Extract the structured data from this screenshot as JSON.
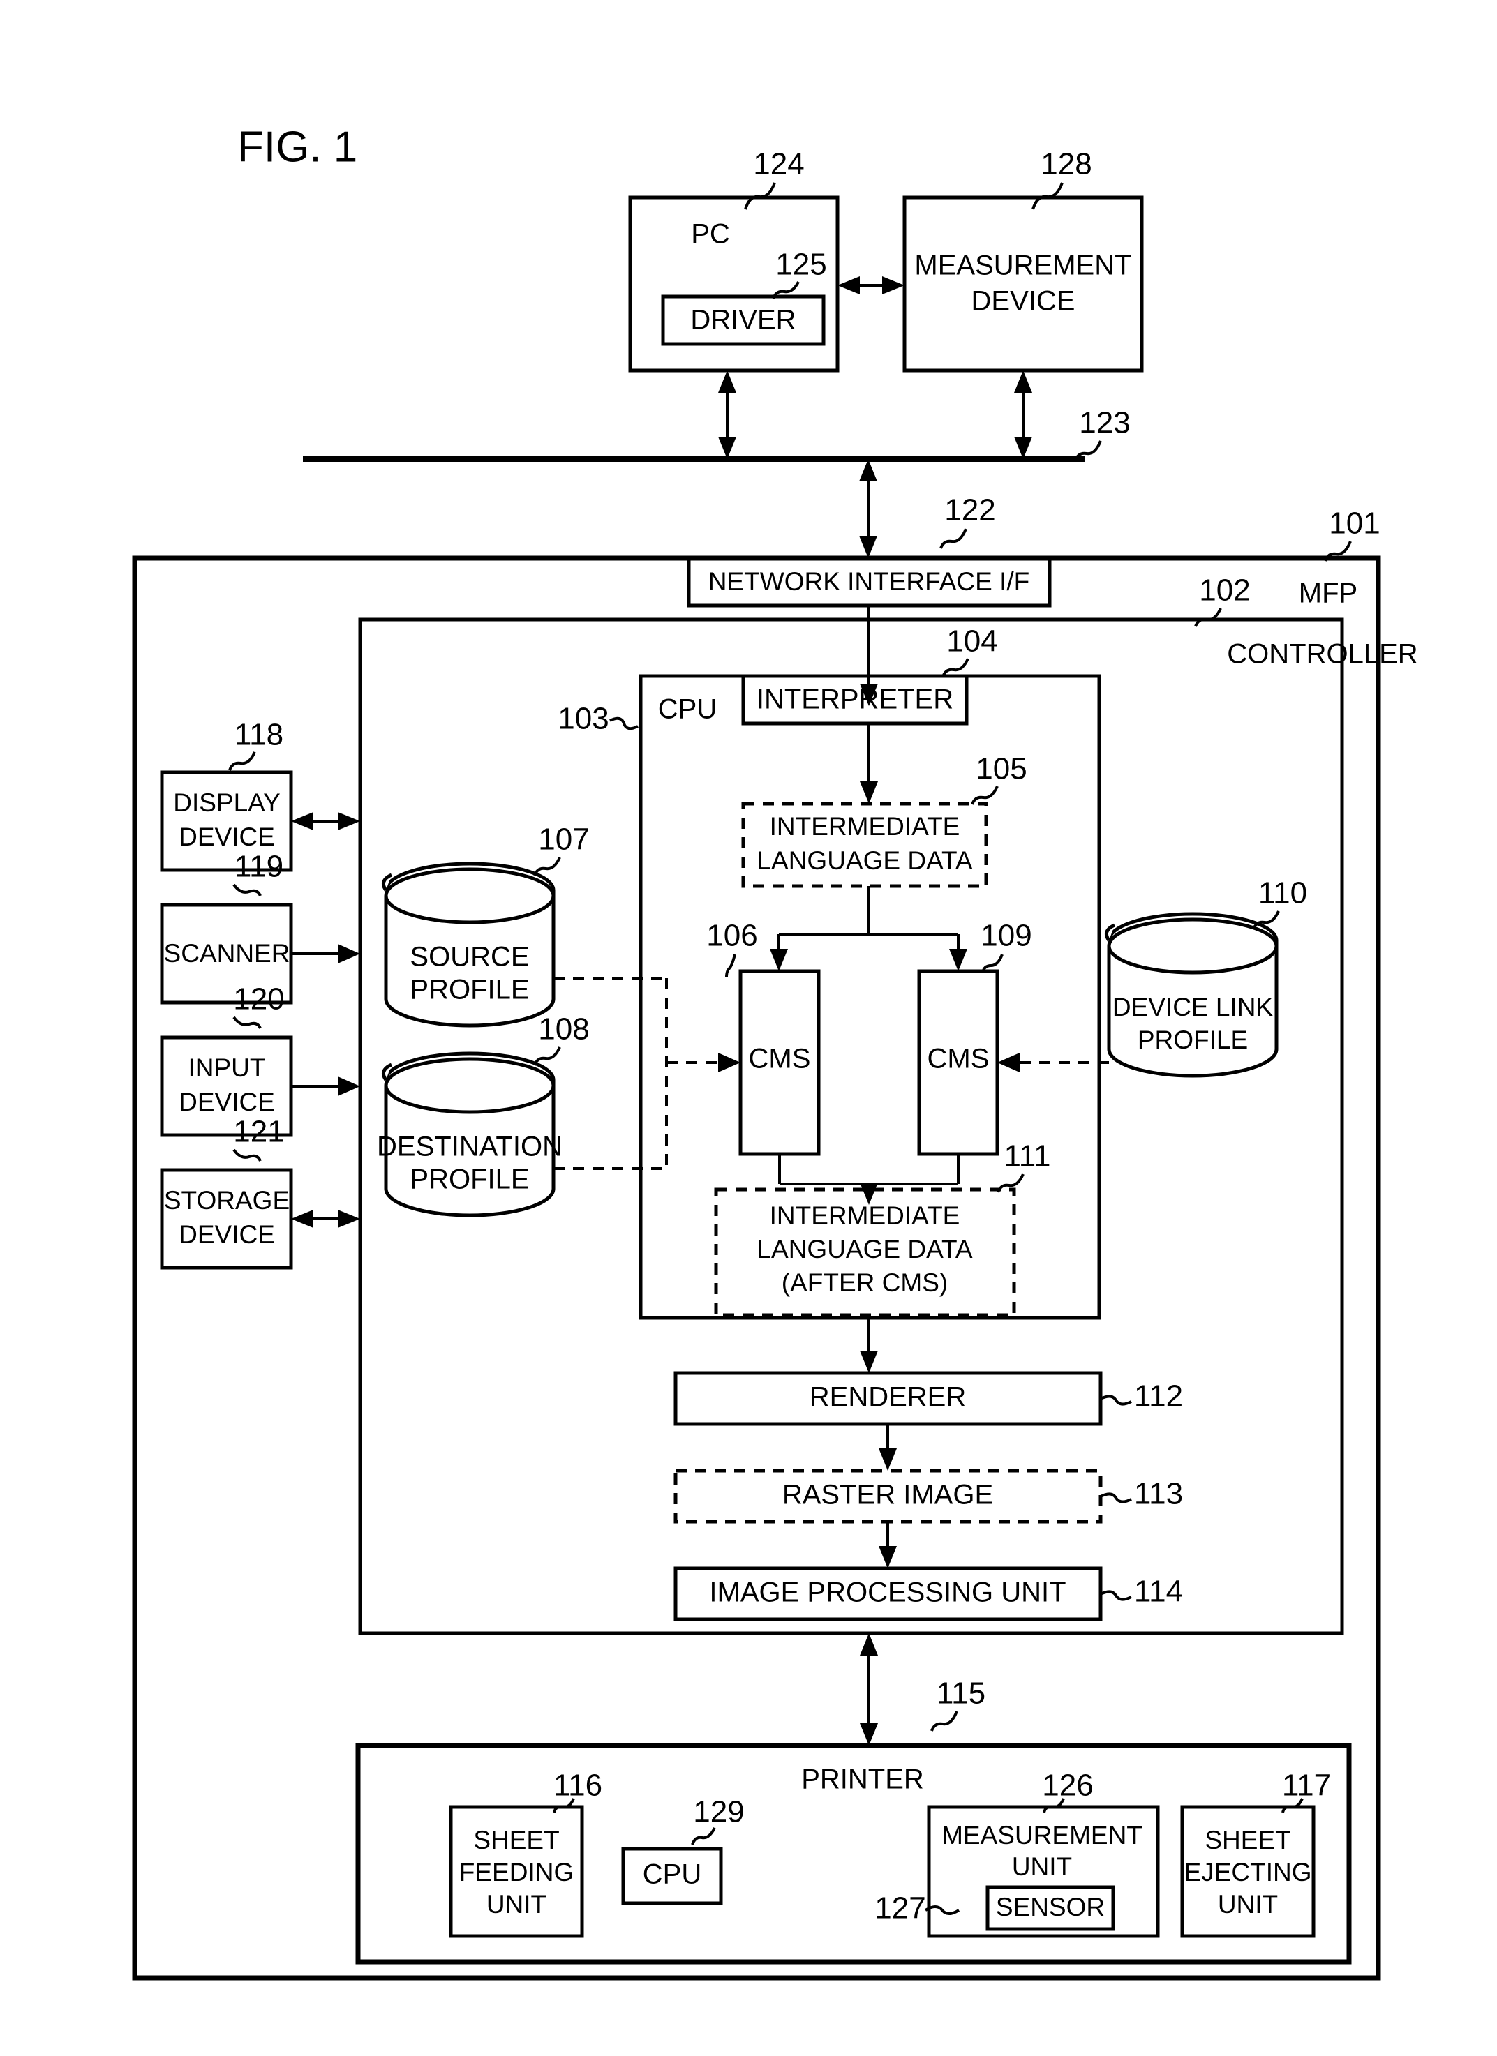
{
  "figure": {
    "title": "FIG. 1"
  },
  "top": {
    "pc": {
      "ref": "124",
      "label": "PC"
    },
    "driver": {
      "ref": "125",
      "label": "DRIVER"
    },
    "measurement_device": {
      "ref": "128",
      "line1": "MEASUREMENT",
      "line2": "DEVICE"
    },
    "network_bus": {
      "ref": "123"
    }
  },
  "mfp": {
    "ref": "101",
    "label": "MFP",
    "network_interface": {
      "ref": "122",
      "label": "NETWORK INTERFACE I/F"
    },
    "controller": {
      "ref": "102",
      "label": "CONTROLLER"
    },
    "cpu": {
      "ref": "103",
      "label": "CPU"
    },
    "interpreter": {
      "ref": "104",
      "label": "INTERPRETER"
    },
    "intermediate_language_data": {
      "ref": "105",
      "line1": "INTERMEDIATE",
      "line2": "LANGUAGE DATA"
    },
    "cms_left": {
      "ref": "106",
      "label": "CMS"
    },
    "cms_right": {
      "ref": "109",
      "label": "CMS"
    },
    "intermediate_after_cms": {
      "ref": "111",
      "line1": "INTERMEDIATE",
      "line2": "LANGUAGE DATA",
      "line3": "(AFTER CMS)"
    },
    "renderer": {
      "ref": "112",
      "label": "RENDERER"
    },
    "raster_image": {
      "ref": "113",
      "label": "RASTER IMAGE"
    },
    "image_processing_unit": {
      "ref": "114",
      "label": "IMAGE PROCESSING UNIT"
    },
    "source_profile": {
      "ref": "107",
      "line1": "SOURCE",
      "line2": "PROFILE"
    },
    "destination_profile": {
      "ref": "108",
      "line1": "DESTINATION",
      "line2": "PROFILE"
    },
    "device_link_profile": {
      "ref": "110",
      "line1": "DEVICE LINK",
      "line2": "PROFILE"
    }
  },
  "peripherals": [
    {
      "ref": "118",
      "line1": "DISPLAY",
      "line2": "DEVICE"
    },
    {
      "ref": "119",
      "line1": "SCANNER",
      "line2": ""
    },
    {
      "ref": "120",
      "line1": "INPUT",
      "line2": "DEVICE"
    },
    {
      "ref": "121",
      "line1": "STORAGE",
      "line2": "DEVICE"
    }
  ],
  "printer": {
    "ref": "115",
    "label": "PRINTER",
    "sheet_feeding_unit": {
      "ref": "116",
      "line1": "SHEET",
      "line2": "FEEDING",
      "line3": "UNIT"
    },
    "cpu": {
      "ref": "129",
      "label": "CPU"
    },
    "measurement_unit": {
      "ref": "126",
      "line1": "MEASUREMENT",
      "line2": "UNIT"
    },
    "sensor": {
      "ref": "127",
      "label": "SENSOR"
    },
    "sheet_ejecting_unit": {
      "ref": "117",
      "line1": "SHEET",
      "line2": "EJECTING",
      "line3": "UNIT"
    }
  },
  "colors": {
    "ink": "#000000",
    "paper": "#ffffff"
  }
}
